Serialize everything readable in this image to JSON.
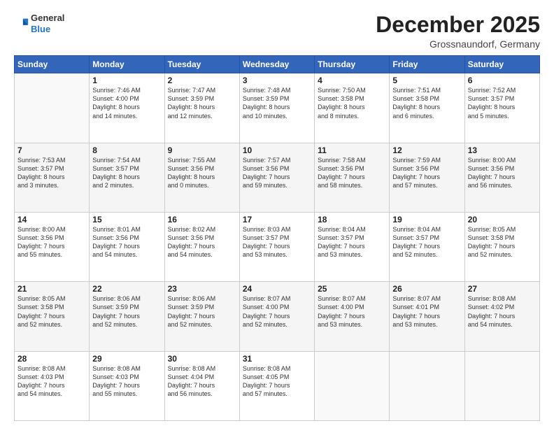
{
  "header": {
    "logo": {
      "general": "General",
      "blue": "Blue"
    },
    "title": "December 2025",
    "location": "Grossnaundorf, Germany"
  },
  "weekdays": [
    "Sunday",
    "Monday",
    "Tuesday",
    "Wednesday",
    "Thursday",
    "Friday",
    "Saturday"
  ],
  "weeks": [
    [
      {
        "day": "",
        "info": ""
      },
      {
        "day": "1",
        "info": "Sunrise: 7:46 AM\nSunset: 4:00 PM\nDaylight: 8 hours\nand 14 minutes."
      },
      {
        "day": "2",
        "info": "Sunrise: 7:47 AM\nSunset: 3:59 PM\nDaylight: 8 hours\nand 12 minutes."
      },
      {
        "day": "3",
        "info": "Sunrise: 7:48 AM\nSunset: 3:59 PM\nDaylight: 8 hours\nand 10 minutes."
      },
      {
        "day": "4",
        "info": "Sunrise: 7:50 AM\nSunset: 3:58 PM\nDaylight: 8 hours\nand 8 minutes."
      },
      {
        "day": "5",
        "info": "Sunrise: 7:51 AM\nSunset: 3:58 PM\nDaylight: 8 hours\nand 6 minutes."
      },
      {
        "day": "6",
        "info": "Sunrise: 7:52 AM\nSunset: 3:57 PM\nDaylight: 8 hours\nand 5 minutes."
      }
    ],
    [
      {
        "day": "7",
        "info": "Sunrise: 7:53 AM\nSunset: 3:57 PM\nDaylight: 8 hours\nand 3 minutes."
      },
      {
        "day": "8",
        "info": "Sunrise: 7:54 AM\nSunset: 3:57 PM\nDaylight: 8 hours\nand 2 minutes."
      },
      {
        "day": "9",
        "info": "Sunrise: 7:55 AM\nSunset: 3:56 PM\nDaylight: 8 hours\nand 0 minutes."
      },
      {
        "day": "10",
        "info": "Sunrise: 7:57 AM\nSunset: 3:56 PM\nDaylight: 7 hours\nand 59 minutes."
      },
      {
        "day": "11",
        "info": "Sunrise: 7:58 AM\nSunset: 3:56 PM\nDaylight: 7 hours\nand 58 minutes."
      },
      {
        "day": "12",
        "info": "Sunrise: 7:59 AM\nSunset: 3:56 PM\nDaylight: 7 hours\nand 57 minutes."
      },
      {
        "day": "13",
        "info": "Sunrise: 8:00 AM\nSunset: 3:56 PM\nDaylight: 7 hours\nand 56 minutes."
      }
    ],
    [
      {
        "day": "14",
        "info": "Sunrise: 8:00 AM\nSunset: 3:56 PM\nDaylight: 7 hours\nand 55 minutes."
      },
      {
        "day": "15",
        "info": "Sunrise: 8:01 AM\nSunset: 3:56 PM\nDaylight: 7 hours\nand 54 minutes."
      },
      {
        "day": "16",
        "info": "Sunrise: 8:02 AM\nSunset: 3:56 PM\nDaylight: 7 hours\nand 54 minutes."
      },
      {
        "day": "17",
        "info": "Sunrise: 8:03 AM\nSunset: 3:57 PM\nDaylight: 7 hours\nand 53 minutes."
      },
      {
        "day": "18",
        "info": "Sunrise: 8:04 AM\nSunset: 3:57 PM\nDaylight: 7 hours\nand 53 minutes."
      },
      {
        "day": "19",
        "info": "Sunrise: 8:04 AM\nSunset: 3:57 PM\nDaylight: 7 hours\nand 52 minutes."
      },
      {
        "day": "20",
        "info": "Sunrise: 8:05 AM\nSunset: 3:58 PM\nDaylight: 7 hours\nand 52 minutes."
      }
    ],
    [
      {
        "day": "21",
        "info": "Sunrise: 8:05 AM\nSunset: 3:58 PM\nDaylight: 7 hours\nand 52 minutes."
      },
      {
        "day": "22",
        "info": "Sunrise: 8:06 AM\nSunset: 3:59 PM\nDaylight: 7 hours\nand 52 minutes."
      },
      {
        "day": "23",
        "info": "Sunrise: 8:06 AM\nSunset: 3:59 PM\nDaylight: 7 hours\nand 52 minutes."
      },
      {
        "day": "24",
        "info": "Sunrise: 8:07 AM\nSunset: 4:00 PM\nDaylight: 7 hours\nand 52 minutes."
      },
      {
        "day": "25",
        "info": "Sunrise: 8:07 AM\nSunset: 4:00 PM\nDaylight: 7 hours\nand 53 minutes."
      },
      {
        "day": "26",
        "info": "Sunrise: 8:07 AM\nSunset: 4:01 PM\nDaylight: 7 hours\nand 53 minutes."
      },
      {
        "day": "27",
        "info": "Sunrise: 8:08 AM\nSunset: 4:02 PM\nDaylight: 7 hours\nand 54 minutes."
      }
    ],
    [
      {
        "day": "28",
        "info": "Sunrise: 8:08 AM\nSunset: 4:03 PM\nDaylight: 7 hours\nand 54 minutes."
      },
      {
        "day": "29",
        "info": "Sunrise: 8:08 AM\nSunset: 4:03 PM\nDaylight: 7 hours\nand 55 minutes."
      },
      {
        "day": "30",
        "info": "Sunrise: 8:08 AM\nSunset: 4:04 PM\nDaylight: 7 hours\nand 56 minutes."
      },
      {
        "day": "31",
        "info": "Sunrise: 8:08 AM\nSunset: 4:05 PM\nDaylight: 7 hours\nand 57 minutes."
      },
      {
        "day": "",
        "info": ""
      },
      {
        "day": "",
        "info": ""
      },
      {
        "day": "",
        "info": ""
      }
    ]
  ]
}
